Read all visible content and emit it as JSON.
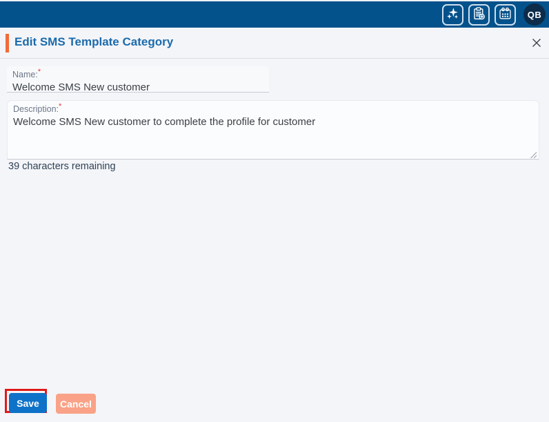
{
  "topbar": {
    "avatar_initials": "QB",
    "icons": [
      {
        "name": "sparkles-icon"
      },
      {
        "name": "clipboard-add-icon"
      },
      {
        "name": "calendar-icon"
      }
    ]
  },
  "modal": {
    "title": "Edit SMS Template Category",
    "name_field": {
      "label": "Name:",
      "required_marker": "*",
      "value": "Welcome SMS New customer"
    },
    "description_field": {
      "label": "Description:",
      "required_marker": "*",
      "value": "Welcome SMS New customer to complete the profile for customer"
    },
    "chars_remaining": "39 characters remaining",
    "buttons": {
      "save": "Save",
      "cancel": "Cancel"
    }
  },
  "colors": {
    "topbar_bg": "#03528c",
    "title_blue": "#1b6bac",
    "accent_orange": "#f26b39",
    "save_blue": "#0e72c8",
    "cancel_salmon": "#f9a287",
    "annotation_red": "#e01a1a",
    "required_red": "#e0393e",
    "page_bg": "#f4f5f9",
    "avatar_bg": "#0c2c4a"
  }
}
